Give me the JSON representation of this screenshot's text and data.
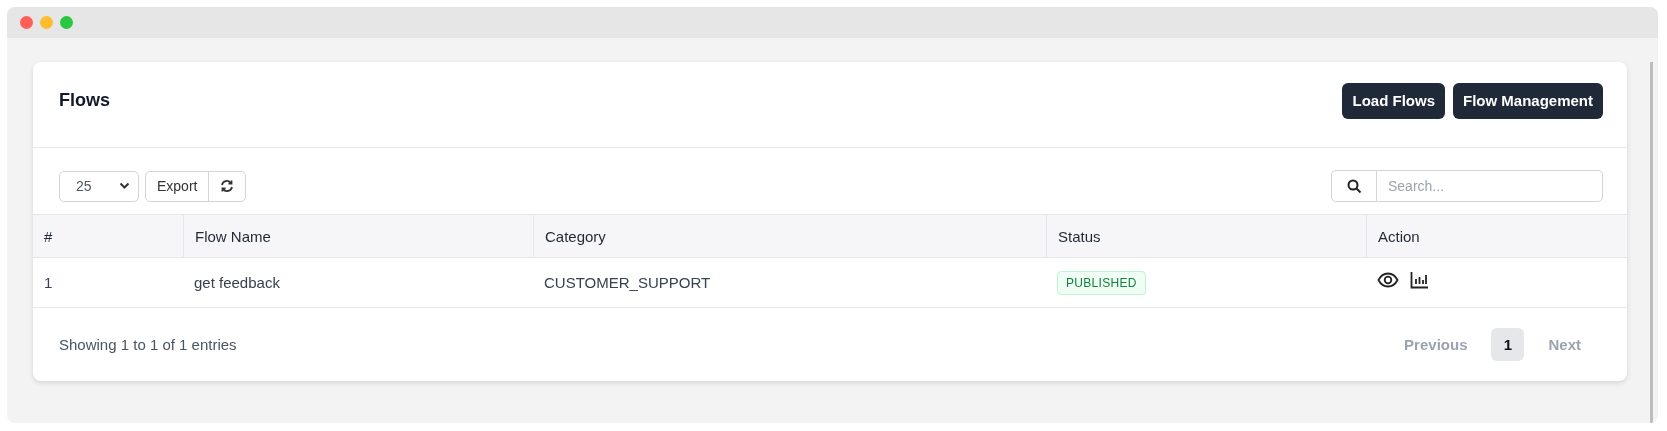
{
  "card": {
    "title": "Flows",
    "buttons": [
      "Load Flows",
      "Flow Management"
    ]
  },
  "toolbar": {
    "page_size": "25",
    "export": "Export",
    "search": {
      "placeholder": "Search..."
    }
  },
  "table": {
    "columns": [
      "#",
      "Flow Name",
      "Category",
      "Status",
      "Action"
    ],
    "rows": [
      {
        "cells": [
          "1",
          "get feedback",
          "CUSTOMER_SUPPORT"
        ],
        "status": "PUBLISHED"
      }
    ]
  },
  "footer": {
    "info": "Showing 1 to 1 of 1 entries",
    "pagination": [
      {
        "label": "Previous",
        "kind": "nav",
        "selected": false
      },
      {
        "label": "1",
        "kind": "page",
        "selected": true
      },
      {
        "label": "Next",
        "kind": "nav",
        "selected": false
      }
    ]
  }
}
